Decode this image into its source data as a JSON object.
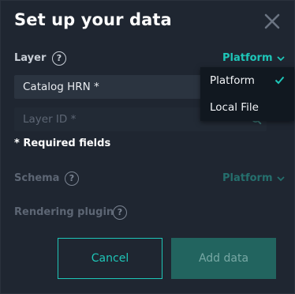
{
  "dialog": {
    "title": "Set up your data",
    "close_icon": "close-icon"
  },
  "layer": {
    "label": "Layer",
    "help_glyph": "?",
    "selected": "Platform",
    "catalog_value": "Catalog HRN *",
    "layer_id_placeholder": "Layer ID *"
  },
  "required_note": "* Required fields",
  "schema": {
    "label": "Schema",
    "help_glyph": "?",
    "selected": "Platform"
  },
  "rendering_plugin": {
    "label": "Rendering plugin",
    "help_glyph": "?"
  },
  "dropdown": {
    "options": [
      "Platform",
      "Local File"
    ],
    "checked_option": "Platform"
  },
  "buttons": {
    "cancel": "Cancel",
    "add": "Add data"
  },
  "colors": {
    "accent": "#1ec6b8",
    "background": "#1f2631",
    "disabled_accent": "#22645f"
  }
}
